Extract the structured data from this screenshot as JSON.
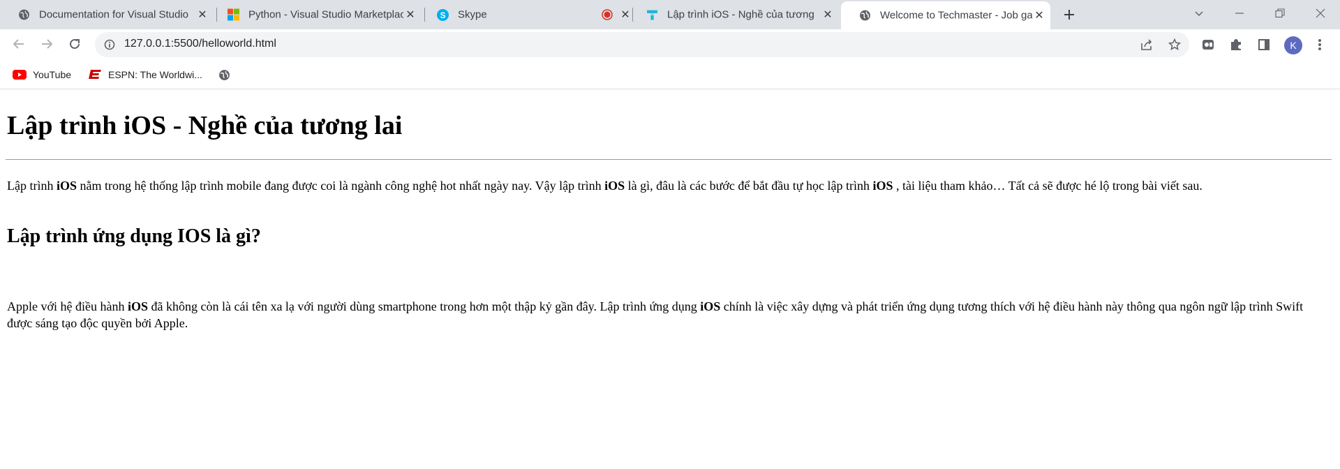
{
  "tabs": [
    {
      "title": "Documentation for Visual Studio",
      "icon": "globe-icon"
    },
    {
      "title": "Python - Visual Studio Marketplace",
      "icon": "microsoft-logo-icon"
    },
    {
      "title": "Skype",
      "icon": "skype-icon",
      "recording": true
    },
    {
      "title": "Lập trình iOS - Nghề của tương lai",
      "icon": "techmaster-icon"
    },
    {
      "title": "Welcome to Techmaster - Job gateway",
      "icon": "globe-icon",
      "active": true
    }
  ],
  "toolbar": {
    "url": "127.0.0.1:5500/helloworld.html",
    "avatar_letter": "K"
  },
  "bookmarks": [
    {
      "label": "YouTube",
      "icon": "youtube-icon"
    },
    {
      "label": "ESPN: The Worldwi...",
      "icon": "espn-icon"
    },
    {
      "label": "",
      "icon": "globe-icon"
    }
  ],
  "content": {
    "heading": "Lập trình iOS - Nghề của tương lai",
    "intro": [
      {
        "text": "Lập trình "
      },
      {
        "text": "iOS",
        "bold": true
      },
      {
        "text": " nằm trong hệ thống lập trình mobile đang được coi là ngành công nghệ hot nhất ngày nay. Vậy lập trình "
      },
      {
        "text": "iOS",
        "bold": true
      },
      {
        "text": " là gì, đâu là các bước để bắt đầu tự học lập trình "
      },
      {
        "text": "iOS",
        "bold": true
      },
      {
        "text": " , tài liệu tham khảo… Tất cả sẽ được hé lộ trong bài viết sau."
      }
    ],
    "subheading": "Lập trình ứng dụng IOS là gì?",
    "body": [
      {
        "text": "Apple với hệ điều hành "
      },
      {
        "text": "iOS",
        "bold": true
      },
      {
        "text": " đã không còn là cái tên xa lạ với người dùng smartphone trong hơn một thập kỷ gần đây. Lập trình ứng dụng "
      },
      {
        "text": "iOS",
        "bold": true
      },
      {
        "text": " chính là việc xây dựng và phát triển ứng dụng tương thích với hệ điều hành này thông qua ngôn ngữ lập trình Swift được sáng tạo độc quyền bởi Apple."
      }
    ]
  }
}
